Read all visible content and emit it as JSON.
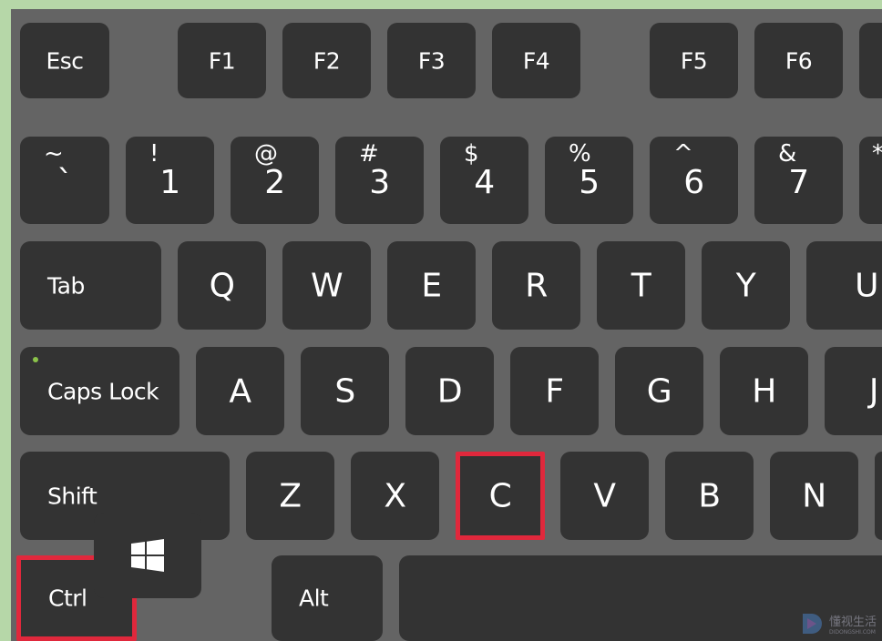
{
  "keyboard": {
    "highlight_color": "#e0283c",
    "rows": [
      [
        {
          "label": "Esc",
          "type": "fn"
        },
        {
          "label": "F1",
          "type": "fn"
        },
        {
          "label": "F2",
          "type": "fn"
        },
        {
          "label": "F3",
          "type": "fn"
        },
        {
          "label": "F4",
          "type": "fn"
        },
        {
          "label": "F5",
          "type": "fn"
        },
        {
          "label": "F6",
          "type": "fn"
        },
        {
          "label": "",
          "type": "fn"
        }
      ],
      [
        {
          "label": "`",
          "shift": "~",
          "type": "num"
        },
        {
          "label": "1",
          "shift": "!",
          "type": "num"
        },
        {
          "label": "2",
          "shift": "@",
          "type": "num"
        },
        {
          "label": "3",
          "shift": "#",
          "type": "num"
        },
        {
          "label": "4",
          "shift": "$",
          "type": "num"
        },
        {
          "label": "5",
          "shift": "%",
          "type": "num"
        },
        {
          "label": "6",
          "shift": "^",
          "type": "num"
        },
        {
          "label": "7",
          "shift": "&",
          "type": "num"
        },
        {
          "label": "",
          "shift": "*",
          "type": "num"
        }
      ],
      [
        {
          "label": "Tab",
          "type": "mod"
        },
        {
          "label": "Q",
          "type": "letter"
        },
        {
          "label": "W",
          "type": "letter"
        },
        {
          "label": "E",
          "type": "letter"
        },
        {
          "label": "R",
          "type": "letter"
        },
        {
          "label": "T",
          "type": "letter"
        },
        {
          "label": "Y",
          "type": "letter"
        },
        {
          "label": "U",
          "type": "letter"
        }
      ],
      [
        {
          "label": "Caps Lock",
          "type": "mod",
          "led": true
        },
        {
          "label": "A",
          "type": "letter"
        },
        {
          "label": "S",
          "type": "letter"
        },
        {
          "label": "D",
          "type": "letter"
        },
        {
          "label": "F",
          "type": "letter"
        },
        {
          "label": "G",
          "type": "letter"
        },
        {
          "label": "H",
          "type": "letter"
        },
        {
          "label": "J",
          "type": "letter"
        }
      ],
      [
        {
          "label": "Shift",
          "type": "mod"
        },
        {
          "label": "Z",
          "type": "letter"
        },
        {
          "label": "X",
          "type": "letter"
        },
        {
          "label": "C",
          "type": "letter",
          "highlighted": true
        },
        {
          "label": "V",
          "type": "letter"
        },
        {
          "label": "B",
          "type": "letter"
        },
        {
          "label": "N",
          "type": "letter"
        },
        {
          "label": "",
          "type": "letter"
        }
      ],
      [
        {
          "label": "Ctrl",
          "type": "mod",
          "highlighted": true
        },
        {
          "label": "",
          "type": "win",
          "icon": "windows-logo-icon"
        },
        {
          "label": "Alt",
          "type": "mod"
        },
        {
          "label": "",
          "type": "space"
        }
      ]
    ]
  },
  "watermark": {
    "text": "懂视生活",
    "subtext": "DIDONGSHI.COM"
  }
}
